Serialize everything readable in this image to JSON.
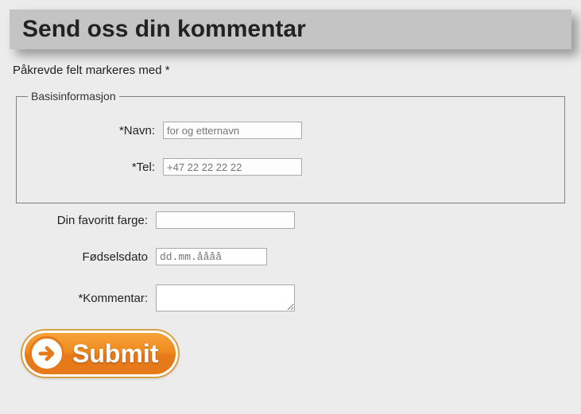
{
  "header": {
    "title": "Send oss din kommentar"
  },
  "note": "Påkrevde felt markeres med *",
  "fieldset": {
    "legend": "Basisinformasjon",
    "name_label": "*Navn:",
    "name_placeholder": "for og etternavn",
    "tel_label": "*Tel:",
    "tel_placeholder": "+47 22 22 22 22"
  },
  "color_label": "Din favoritt farge:",
  "dob_label": "Fødselsdato",
  "dob_placeholder": "dd.mm.åååå",
  "comment_label": "*Kommentar:",
  "submit": {
    "label": "Submit"
  }
}
